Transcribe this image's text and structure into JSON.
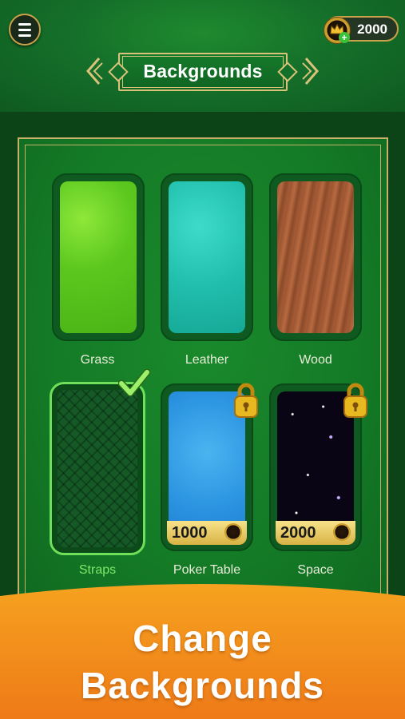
{
  "header": {
    "title": "Backgrounds",
    "coins": "2000",
    "menu_icon": "hamburger-menu-icon",
    "coin_icon": "crown-chip-icon"
  },
  "backgrounds": [
    {
      "label": "Grass",
      "state": "owned"
    },
    {
      "label": "Leather",
      "state": "owned"
    },
    {
      "label": "Wood",
      "state": "owned"
    },
    {
      "label": "Straps",
      "state": "selected"
    },
    {
      "label": "Poker Table",
      "state": "locked",
      "price": "1000"
    },
    {
      "label": "Space",
      "state": "locked",
      "price": "2000"
    }
  ],
  "banner": {
    "line1": "Change",
    "line2": "Backgrounds"
  },
  "colors": {
    "accent_gold": "#c9a24a",
    "selected_green": "#6fe05a",
    "banner_orange": "#f08a1c"
  }
}
